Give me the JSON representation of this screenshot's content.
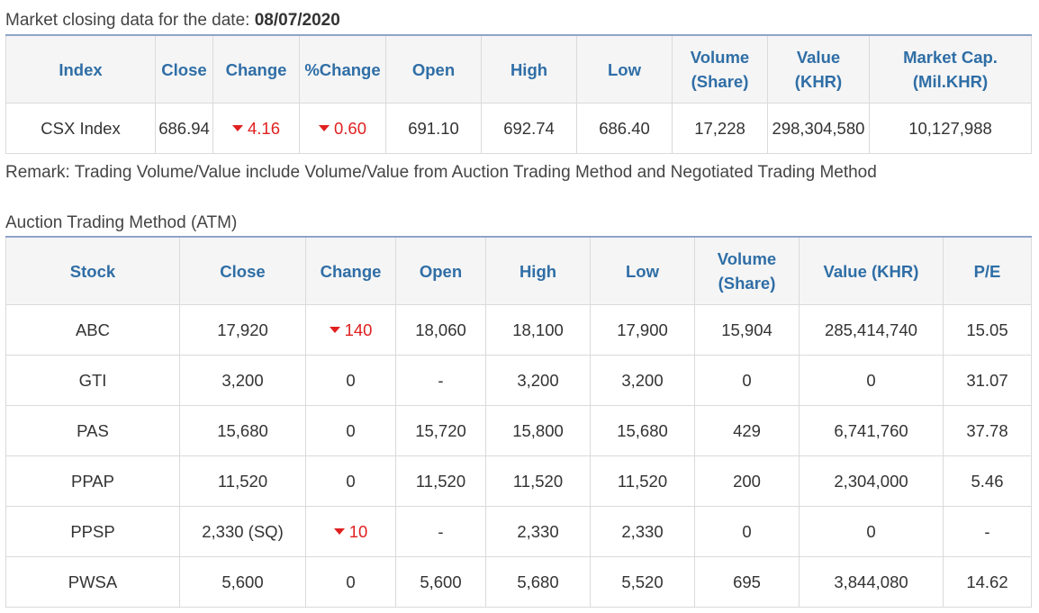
{
  "market": {
    "caption_label": "Market closing data for the date:",
    "date": "08/07/2020",
    "headers": {
      "index": "Index",
      "close": "Close",
      "change": "Change",
      "pct_change": "%Change",
      "open": "Open",
      "high": "High",
      "low": "Low",
      "volume_1": "Volume",
      "volume_2": "(Share)",
      "value_1": "Value",
      "value_2": "(KHR)",
      "mcap_1": "Market Cap.",
      "mcap_2": "(Mil.KHR)"
    },
    "row": {
      "index": "CSX Index",
      "close": "686.94",
      "change": "4.16",
      "pct_change": "0.60",
      "open": "691.10",
      "high": "692.74",
      "low": "686.40",
      "volume": "17,228",
      "value": "298,304,580",
      "market_cap": "10,127,988",
      "direction": "down"
    }
  },
  "remark": "Remark: Trading Volume/Value include Volume/Value from Auction Trading Method and Negotiated Trading Method",
  "atm": {
    "title": "Auction Trading Method (ATM)",
    "headers": {
      "stock": "Stock",
      "close": "Close",
      "change": "Change",
      "open": "Open",
      "high": "High",
      "low": "Low",
      "volume_1": "Volume",
      "volume_2": "(Share)",
      "value": "Value (KHR)",
      "pe": "P/E"
    },
    "rows": [
      {
        "stock": "ABC",
        "close": "17,920",
        "change": "140",
        "down": true,
        "open": "18,060",
        "high": "18,100",
        "low": "17,900",
        "volume": "15,904",
        "value": "285,414,740",
        "pe": "15.05"
      },
      {
        "stock": "GTI",
        "close": "3,200",
        "change": "0",
        "down": false,
        "open": "-",
        "high": "3,200",
        "low": "3,200",
        "volume": "0",
        "value": "0",
        "pe": "31.07"
      },
      {
        "stock": "PAS",
        "close": "15,680",
        "change": "0",
        "down": false,
        "open": "15,720",
        "high": "15,800",
        "low": "15,680",
        "volume": "429",
        "value": "6,741,760",
        "pe": "37.78"
      },
      {
        "stock": "PPAP",
        "close": "11,520",
        "change": "0",
        "down": false,
        "open": "11,520",
        "high": "11,520",
        "low": "11,520",
        "volume": "200",
        "value": "2,304,000",
        "pe": "5.46"
      },
      {
        "stock": "PPSP",
        "close": "2,330 (SQ)",
        "change": "10",
        "down": true,
        "open": "-",
        "high": "2,330",
        "low": "2,330",
        "volume": "0",
        "value": "0",
        "pe": "-"
      },
      {
        "stock": "PWSA",
        "close": "5,600",
        "change": "0",
        "down": false,
        "open": "5,600",
        "high": "5,680",
        "low": "5,520",
        "volume": "695",
        "value": "3,844,080",
        "pe": "14.62"
      }
    ]
  },
  "colors": {
    "header_text": "#2f6ea6",
    "header_bg": "#f5f5f5",
    "negative": "#e02020",
    "border": "#dadada",
    "table_top_border": "#8ea4c8"
  }
}
